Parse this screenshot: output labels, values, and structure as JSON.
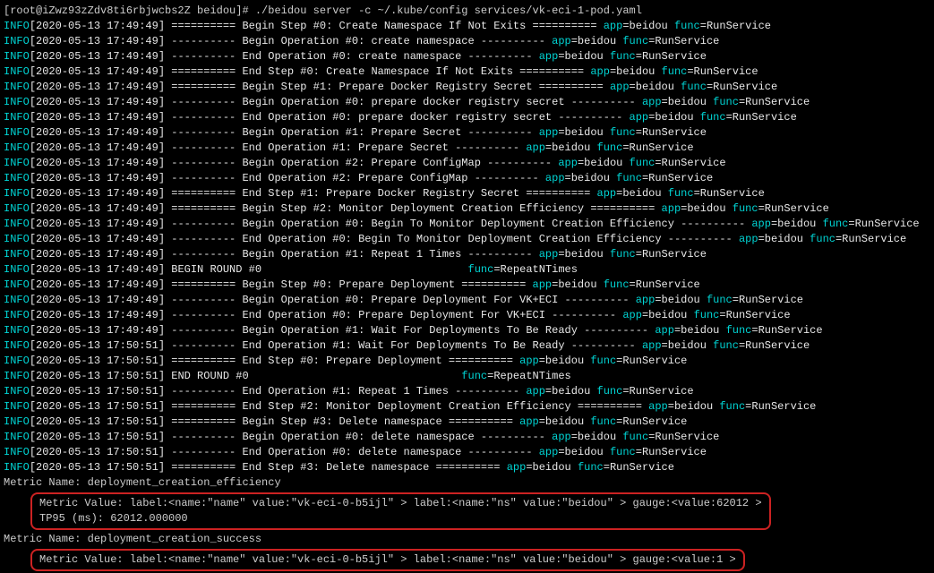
{
  "prompt": "[root@iZwz93zZdv8ti6rbjwcbs2Z beidou]# ./beidou server -c ~/.kube/config services/vk-eci-1-pod.yaml",
  "lines": [
    {
      "ts": "[2020-05-13 17:49:49]",
      "text": " ========== Begin Step #0: Create Namespace If Not Exits ========== ",
      "app": "beidou",
      "func": "RunService"
    },
    {
      "ts": "[2020-05-13 17:49:49]",
      "text": " ---------- Begin Operation #0: create namespace ---------- ",
      "app": "beidou",
      "func": "RunService"
    },
    {
      "ts": "[2020-05-13 17:49:49]",
      "text": " ---------- End Operation #0: create namespace ---------- ",
      "app": "beidou",
      "func": "RunService"
    },
    {
      "ts": "[2020-05-13 17:49:49]",
      "text": " ========== End Step #0: Create Namespace If Not Exits ========== ",
      "app": "beidou",
      "func": "RunService"
    },
    {
      "ts": "[2020-05-13 17:49:49]",
      "text": " ========== Begin Step #1: Prepare Docker Registry Secret ========== ",
      "app": "beidou",
      "func": "RunService"
    },
    {
      "ts": "[2020-05-13 17:49:49]",
      "text": " ---------- Begin Operation #0: prepare docker registry secret ---------- ",
      "app": "beidou",
      "func": "RunService"
    },
    {
      "ts": "[2020-05-13 17:49:49]",
      "text": " ---------- End Operation #0: prepare docker registry secret ---------- ",
      "app": "beidou",
      "func": "RunService"
    },
    {
      "ts": "[2020-05-13 17:49:49]",
      "text": " ---------- Begin Operation #1: Prepare Secret ---------- ",
      "app": "beidou",
      "func": "RunService"
    },
    {
      "ts": "[2020-05-13 17:49:49]",
      "text": " ---------- End Operation #1: Prepare Secret ---------- ",
      "app": "beidou",
      "func": "RunService"
    },
    {
      "ts": "[2020-05-13 17:49:49]",
      "text": " ---------- Begin Operation #2: Prepare ConfigMap ---------- ",
      "app": "beidou",
      "func": "RunService"
    },
    {
      "ts": "[2020-05-13 17:49:49]",
      "text": " ---------- End Operation #2: Prepare ConfigMap ---------- ",
      "app": "beidou",
      "func": "RunService"
    },
    {
      "ts": "[2020-05-13 17:49:49]",
      "text": " ========== End Step #1: Prepare Docker Registry Secret ========== ",
      "app": "beidou",
      "func": "RunService"
    },
    {
      "ts": "[2020-05-13 17:49:49]",
      "text": " ========== Begin Step #2: Monitor Deployment Creation Efficiency ========== ",
      "app": "beidou",
      "func": "RunService"
    },
    {
      "ts": "[2020-05-13 17:49:49]",
      "text": " ---------- Begin Operation #0: Begin To Monitor Deployment Creation Efficiency ---------- ",
      "app": "beidou",
      "func": "RunService"
    },
    {
      "ts": "[2020-05-13 17:49:49]",
      "text": " ---------- End Operation #0: Begin To Monitor Deployment Creation Efficiency ---------- ",
      "app": "beidou",
      "func": "RunService"
    },
    {
      "ts": "[2020-05-13 17:49:49]",
      "text": " ---------- Begin Operation #1: Repeat 1 Times ---------- ",
      "app": "beidou",
      "func": "RunService"
    },
    {
      "ts": "[2020-05-13 17:49:49]",
      "text": " BEGIN ROUND #0                                ",
      "func": "RepeatNTimes",
      "app": ""
    },
    {
      "ts": "[2020-05-13 17:49:49]",
      "text": " ========== Begin Step #0: Prepare Deployment ========== ",
      "app": "beidou",
      "func": "RunService"
    },
    {
      "ts": "[2020-05-13 17:49:49]",
      "text": " ---------- Begin Operation #0: Prepare Deployment For VK+ECI ---------- ",
      "app": "beidou",
      "func": "RunService"
    },
    {
      "ts": "[2020-05-13 17:49:49]",
      "text": " ---------- End Operation #0: Prepare Deployment For VK+ECI ---------- ",
      "app": "beidou",
      "func": "RunService"
    },
    {
      "ts": "[2020-05-13 17:49:49]",
      "text": " ---------- Begin Operation #1: Wait For Deployments To Be Ready ---------- ",
      "app": "beidou",
      "func": "RunService"
    },
    {
      "ts": "[2020-05-13 17:50:51]",
      "text": " ---------- End Operation #1: Wait For Deployments To Be Ready ---------- ",
      "app": "beidou",
      "func": "RunService"
    },
    {
      "ts": "[2020-05-13 17:50:51]",
      "text": " ========== End Step #0: Prepare Deployment ========== ",
      "app": "beidou",
      "func": "RunService"
    },
    {
      "ts": "[2020-05-13 17:50:51]",
      "text": " END ROUND #0                                 ",
      "func": "RepeatNTimes",
      "app": ""
    },
    {
      "ts": "[2020-05-13 17:50:51]",
      "text": " ---------- End Operation #1: Repeat 1 Times ---------- ",
      "app": "beidou",
      "func": "RunService"
    },
    {
      "ts": "[2020-05-13 17:50:51]",
      "text": " ========== End Step #2: Monitor Deployment Creation Efficiency ========== ",
      "app": "beidou",
      "func": "RunService"
    },
    {
      "ts": "[2020-05-13 17:50:51]",
      "text": " ========== Begin Step #3: Delete namespace ========== ",
      "app": "beidou",
      "func": "RunService"
    },
    {
      "ts": "[2020-05-13 17:50:51]",
      "text": " ---------- Begin Operation #0: delete namespace ---------- ",
      "app": "beidou",
      "func": "RunService"
    },
    {
      "ts": "[2020-05-13 17:50:51]",
      "text": " ---------- End Operation #0: delete namespace ---------- ",
      "app": "beidou",
      "func": "RunService"
    },
    {
      "ts": "[2020-05-13 17:50:51]",
      "text": " ========== End Step #3: Delete namespace ========== ",
      "app": "beidou",
      "func": "RunService"
    }
  ],
  "labels": {
    "info": "INFO",
    "app": "app",
    "func": "func",
    "eq": "="
  },
  "metric1": {
    "title": "Metric Name: deployment_creation_efficiency",
    "value_line": "Metric Value: label:<name:\"name\" value:\"vk-eci-0-b5ijl\" > label:<name:\"ns\" value:\"beidou\" > gauge:<value:62012 >",
    "tp_line": "TP95 (ms): 62012.000000"
  },
  "metric2": {
    "title": "Metric Name: deployment_creation_success",
    "value_line": "Metric Value: label:<name:\"name\" value:\"vk-eci-0-b5ijl\" > label:<name:\"ns\" value:\"beidou\" > gauge:<value:1 >"
  }
}
